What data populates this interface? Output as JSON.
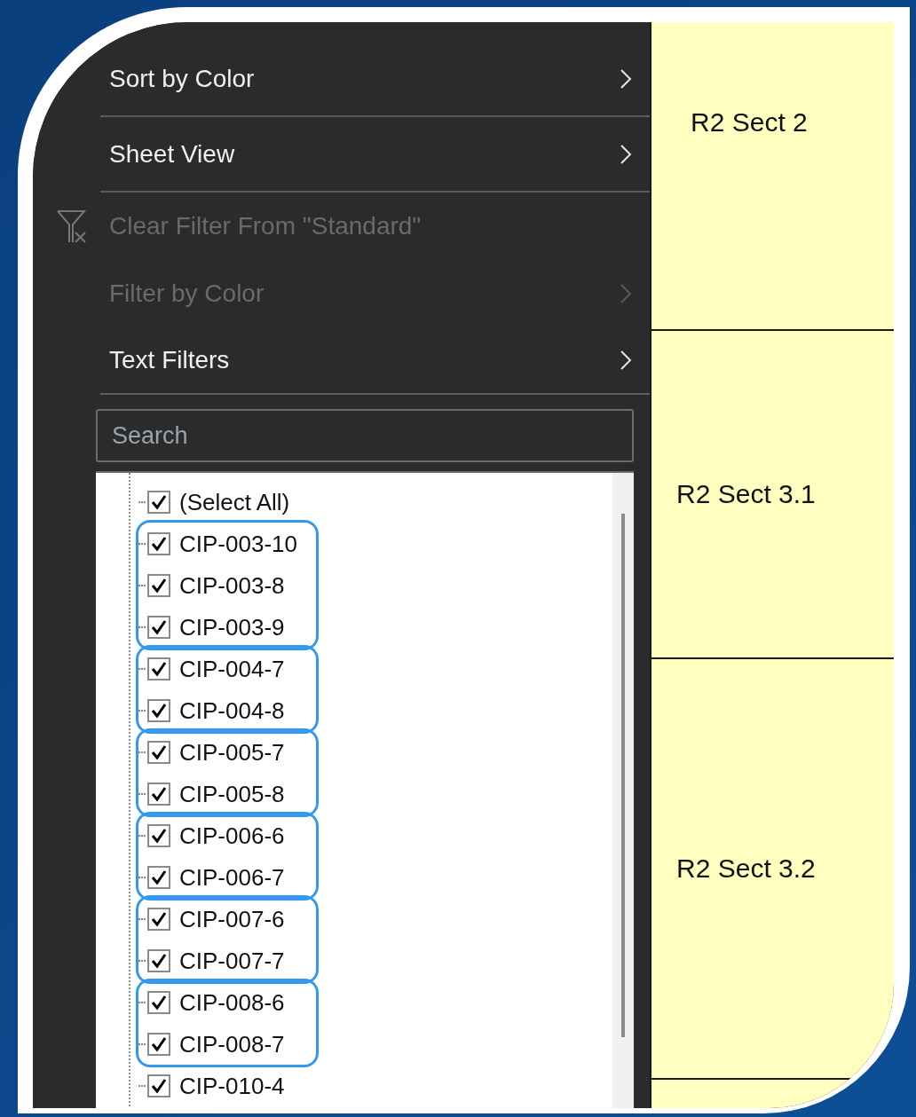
{
  "menu": {
    "items": [
      {
        "label": "Sort by Color",
        "disabled": false,
        "submenu": true,
        "kind": "plain",
        "divider_below": true
      },
      {
        "label": "Sheet View",
        "disabled": false,
        "submenu": true,
        "kind": "plain",
        "divider_below": true
      },
      {
        "label": "Clear Filter From \"Standard\"",
        "disabled": true,
        "submenu": false,
        "kind": "clear",
        "divider_below": false
      },
      {
        "label": "Filter by Color",
        "disabled": true,
        "submenu": true,
        "kind": "plain",
        "divider_below": false
      },
      {
        "label": "Text Filters",
        "disabled": false,
        "submenu": true,
        "kind": "plain",
        "divider_below": true
      }
    ],
    "search": {
      "placeholder": "Search"
    },
    "value_groups": [
      {
        "highlighted": false,
        "items": [
          {
            "label": "(Select All)",
            "checked": true
          }
        ]
      },
      {
        "highlighted": true,
        "items": [
          {
            "label": "CIP-003-10",
            "checked": true
          },
          {
            "label": "CIP-003-8",
            "checked": true
          },
          {
            "label": "CIP-003-9",
            "checked": true
          }
        ]
      },
      {
        "highlighted": true,
        "items": [
          {
            "label": "CIP-004-7",
            "checked": true
          },
          {
            "label": "CIP-004-8",
            "checked": true
          }
        ]
      },
      {
        "highlighted": true,
        "items": [
          {
            "label": "CIP-005-7",
            "checked": true
          },
          {
            "label": "CIP-005-8",
            "checked": true
          }
        ]
      },
      {
        "highlighted": true,
        "items": [
          {
            "label": "CIP-006-6",
            "checked": true
          },
          {
            "label": "CIP-006-7",
            "checked": true
          }
        ]
      },
      {
        "highlighted": true,
        "items": [
          {
            "label": "CIP-007-6",
            "checked": true
          },
          {
            "label": "CIP-007-7",
            "checked": true
          }
        ]
      },
      {
        "highlighted": true,
        "items": [
          {
            "label": "CIP-008-6",
            "checked": true
          },
          {
            "label": "CIP-008-7",
            "checked": true
          }
        ]
      },
      {
        "highlighted": false,
        "items": [
          {
            "label": "CIP-010-4",
            "checked": true
          }
        ]
      }
    ]
  },
  "sheet": {
    "cells": [
      "R2 Sect 2",
      "R2 Sect 3.1",
      "R2 Sect 3.2"
    ]
  }
}
